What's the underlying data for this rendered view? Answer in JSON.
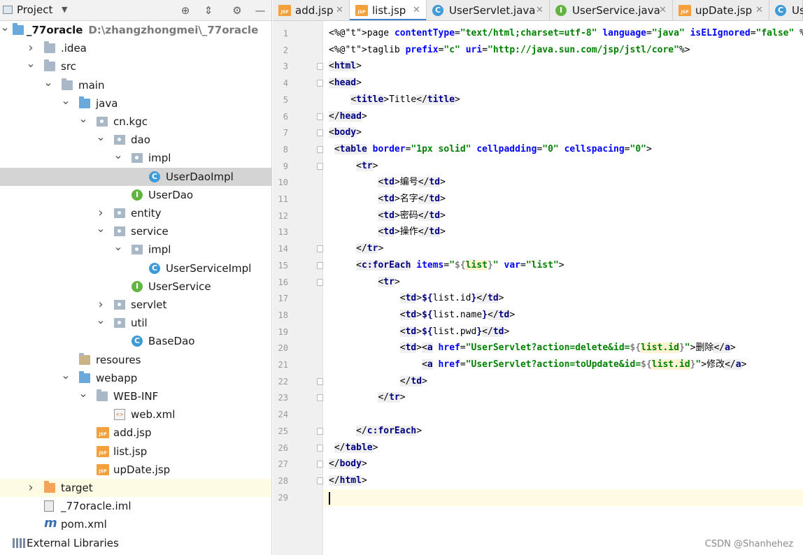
{
  "project_panel": {
    "title": "Project",
    "tree": [
      {
        "label": "_77oracle",
        "hint": "D:\\zhangzhongmei\\_77oracle",
        "icon": "module-icon",
        "depth": 0,
        "arrow": "down"
      },
      {
        "label": ".idea",
        "icon": "folder-icon",
        "depth": 1,
        "arrow": "right"
      },
      {
        "label": "src",
        "icon": "folder-icon",
        "depth": 1,
        "arrow": "down"
      },
      {
        "label": "main",
        "icon": "folder-icon",
        "depth": 2,
        "arrow": "down"
      },
      {
        "label": "java",
        "icon": "source-folder-icon",
        "depth": 3,
        "arrow": "down"
      },
      {
        "label": "cn.kgc",
        "icon": "package-icon",
        "depth": 4,
        "arrow": "down"
      },
      {
        "label": "dao",
        "icon": "package-icon",
        "depth": 5,
        "arrow": "down"
      },
      {
        "label": "impl",
        "icon": "package-icon",
        "depth": 6,
        "arrow": "down"
      },
      {
        "label": "UserDaoImpl",
        "icon": "class-icon",
        "depth": 7,
        "arrow": "",
        "selected": true
      },
      {
        "label": "UserDao",
        "icon": "interface-icon",
        "depth": 6,
        "arrow": ""
      },
      {
        "label": "entity",
        "icon": "package-icon",
        "depth": 5,
        "arrow": "right"
      },
      {
        "label": "service",
        "icon": "package-icon",
        "depth": 5,
        "arrow": "down"
      },
      {
        "label": "impl",
        "icon": "package-icon",
        "depth": 6,
        "arrow": "down"
      },
      {
        "label": "UserServiceImpl",
        "icon": "class-icon",
        "depth": 7,
        "arrow": ""
      },
      {
        "label": "UserService",
        "icon": "interface-icon",
        "depth": 6,
        "arrow": ""
      },
      {
        "label": "servlet",
        "icon": "package-icon",
        "depth": 5,
        "arrow": "right"
      },
      {
        "label": "util",
        "icon": "package-icon",
        "depth": 5,
        "arrow": "down"
      },
      {
        "label": "BaseDao",
        "icon": "class-icon",
        "depth": 6,
        "arrow": ""
      },
      {
        "label": "resoures",
        "icon": "resources-folder-icon",
        "depth": 3,
        "arrow": ""
      },
      {
        "label": "webapp",
        "icon": "web-folder-icon",
        "depth": 3,
        "arrow": "down"
      },
      {
        "label": "WEB-INF",
        "icon": "folder-icon",
        "depth": 4,
        "arrow": "down"
      },
      {
        "label": "web.xml",
        "icon": "xml-file-icon",
        "depth": 5,
        "arrow": ""
      },
      {
        "label": "add.jsp",
        "icon": "jsp-file-icon",
        "depth": 4,
        "arrow": ""
      },
      {
        "label": "list.jsp",
        "icon": "jsp-file-icon",
        "depth": 4,
        "arrow": ""
      },
      {
        "label": "upDate.jsp",
        "icon": "jsp-file-icon",
        "depth": 4,
        "arrow": ""
      },
      {
        "label": "target",
        "icon": "excluded-folder-icon",
        "depth": 1,
        "arrow": "right",
        "highlight": true
      },
      {
        "label": "_77oracle.iml",
        "icon": "iml-file-icon",
        "depth": 1,
        "arrow": ""
      },
      {
        "label": "pom.xml",
        "icon": "maven-icon",
        "depth": 1,
        "arrow": ""
      },
      {
        "label": "External Libraries",
        "icon": "libraries-icon",
        "depth": 0,
        "arrow": ""
      }
    ]
  },
  "tabs": [
    {
      "label": "add.jsp",
      "icon": "jsp-file-icon",
      "active": false
    },
    {
      "label": "list.jsp",
      "icon": "jsp-file-icon",
      "active": true
    },
    {
      "label": "UserServlet.java",
      "icon": "class-icon",
      "active": false
    },
    {
      "label": "UserService.java",
      "icon": "interface-icon",
      "active": false
    },
    {
      "label": "upDate.jsp",
      "icon": "jsp-file-icon",
      "active": false
    },
    {
      "label": "Us",
      "icon": "class-icon",
      "active": false
    }
  ],
  "editor": {
    "cursor_line": 29,
    "lines": [
      "<%@page contentType=\"text/html;charset=utf-8\" language=\"java\" isELIgnored=\"false\" %>",
      "<%@taglib prefix=\"c\" uri=\"http://java.sun.com/jsp/jstl/core\"%>",
      "<html>",
      "<head>",
      "    <title>Title</title>",
      "</head>",
      "<body>",
      " <table border=\"1px solid\" cellpadding=\"0\" cellspacing=\"0\">",
      "     <tr>",
      "         <td>编号</td>",
      "         <td>名字</td>",
      "         <td>密码</td>",
      "         <td>操作</td>",
      "     </tr>",
      "     <c:forEach items=\"${list}\" var=\"list\">",
      "         <tr>",
      "             <td>${list.id}</td>",
      "             <td>${list.name}</td>",
      "             <td>${list.pwd}</td>",
      "             <td><a href=\"UserServlet?action=delete&id=${list.id}\">删除</a>",
      "                 <a href=\"UserServlet?action=toUpdate&id=${list.id}\">修改</a>",
      "             </td>",
      "         </tr>",
      "",
      "     </c:forEach>",
      " </table>",
      "</body>",
      "</html>",
      ""
    ]
  },
  "watermark": "CSDN @Shanhehez"
}
